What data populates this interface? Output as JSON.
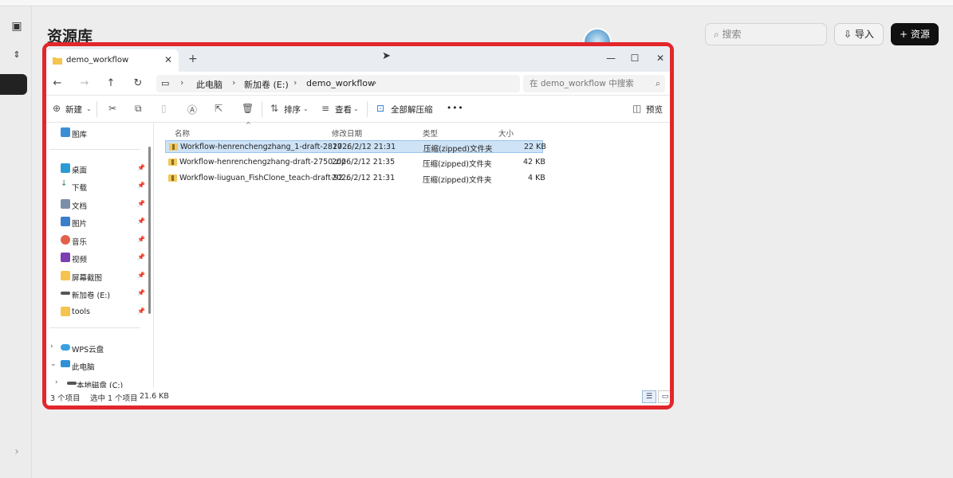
{
  "app": {
    "page_title": "资源库",
    "search_placeholder": "搜索",
    "import_label": "导入",
    "resource_label": "资源",
    "side_bottom_glyph": "›"
  },
  "explorer": {
    "tab_title": "demo_workflow",
    "breadcrumbs": [
      "此电脑",
      "新加卷 (E:)",
      "demo_workflow"
    ],
    "search_placeholder": "在 demo_workflow 中搜索",
    "toolbar": {
      "new_label": "新建",
      "sort_label": "排序",
      "view_label": "查看",
      "extract_label": "全部解压缩",
      "more_label": "•••",
      "preview_label": "预览"
    },
    "nav": {
      "gallery": "图库",
      "quick": [
        "桌面",
        "下载",
        "文档",
        "图片",
        "音乐",
        "视频",
        "屏幕截图",
        "新加卷 (E:)",
        "tools"
      ],
      "wps": "WPS云盘",
      "thispc": "此电脑",
      "localdisk": "本地磁盘 (C:)"
    },
    "columns": {
      "name": "名称",
      "modified": "修改日期",
      "type": "类型",
      "size": "大小"
    },
    "files": [
      {
        "name": "Workflow-henrenchengzhang_1-draft-2817...",
        "modified": "2026/2/12 21:31",
        "type": "压缩(zipped)文件夹",
        "size": "22 KB",
        "selected": true
      },
      {
        "name": "Workflow-henrenchengzhang-draft-2750.zip",
        "modified": "2026/2/12 21:35",
        "type": "压缩(zipped)文件夹",
        "size": "42 KB",
        "selected": false
      },
      {
        "name": "Workflow-liuguan_FishClone_teach-draft-92...",
        "modified": "2026/2/12 21:31",
        "type": "压缩(zipped)文件夹",
        "size": "4 KB",
        "selected": false
      }
    ],
    "status": {
      "count": "3 个项目",
      "selected": "选中 1 个项目",
      "size": "21.6 KB"
    }
  },
  "colors": {
    "highlight_frame": "#e2262b",
    "selection": "#cfe3f7"
  }
}
